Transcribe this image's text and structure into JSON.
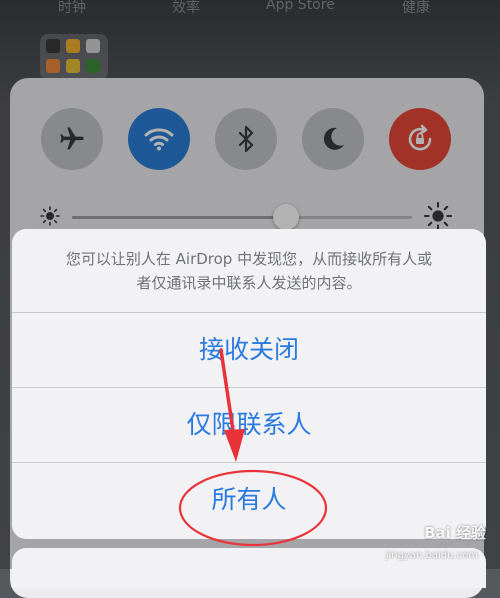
{
  "home_screen": {
    "app_labels": [
      "时钟",
      "效率",
      "App Store",
      "健康"
    ]
  },
  "control_center": {
    "toggles": [
      {
        "name": "airplane-mode",
        "icon": "airplane-icon",
        "active": false
      },
      {
        "name": "wifi",
        "icon": "wifi-icon",
        "active": true,
        "color": "#2b7ed8"
      },
      {
        "name": "bluetooth",
        "icon": "bluetooth-icon",
        "active": false
      },
      {
        "name": "do-not-disturb",
        "icon": "moon-icon",
        "active": false
      },
      {
        "name": "rotation-lock",
        "icon": "rotation-lock-icon",
        "active": true,
        "color": "#e9473a"
      }
    ],
    "brightness_level": 0.63
  },
  "airdrop_sheet": {
    "message": "您可以让别人在 AirDrop 中发现您，从而接收所有人或者仅通讯录中联系人发送的内容。",
    "options": [
      "接收关闭",
      "仅限联系人",
      "所有人"
    ],
    "accent_color": "#2a7be0"
  },
  "annotation": {
    "arrow_color": "#e8333a",
    "highlighted_option": "所有人"
  },
  "watermark": {
    "text": "Bai  经验",
    "subtext": "jingyan.baidu.com"
  }
}
